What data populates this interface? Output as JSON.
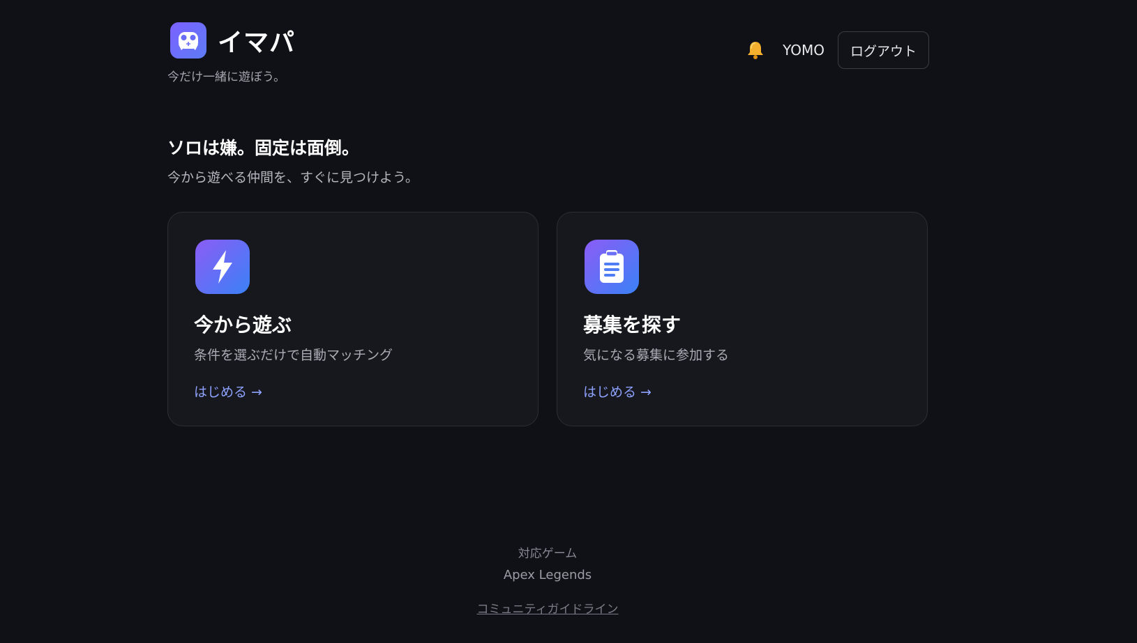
{
  "header": {
    "brand_name": "イマパ",
    "tagline": "今だけ一緒に遊ぼう。",
    "logo_icon": "gamepad-icon",
    "bell_icon": "bell-icon",
    "username": "YOMO",
    "logout_label": "ログアウト"
  },
  "hero": {
    "title": "ソロは嫌。固定は面倒。",
    "subtitle": "今から遊べる仲間を、すぐに見つけよう。"
  },
  "cards": [
    {
      "icon": "lightning-icon",
      "title": "今から遊ぶ",
      "description": "条件を選ぶだけで自動マッチング",
      "cta": "はじめる →"
    },
    {
      "icon": "clipboard-icon",
      "title": "募集を探す",
      "description": "気になる募集に参加する",
      "cta": "はじめる →"
    }
  ],
  "footer": {
    "supported_label": "対応ゲーム",
    "game": "Apex Legends",
    "guidelines_link": "コミュニティガイドライン"
  },
  "colors": {
    "background": "#101116",
    "card_background": "#17181d",
    "accent_gradient_start": "#8b5cf6",
    "accent_gradient_end": "#3b82f6",
    "link": "#8ea2ff"
  }
}
